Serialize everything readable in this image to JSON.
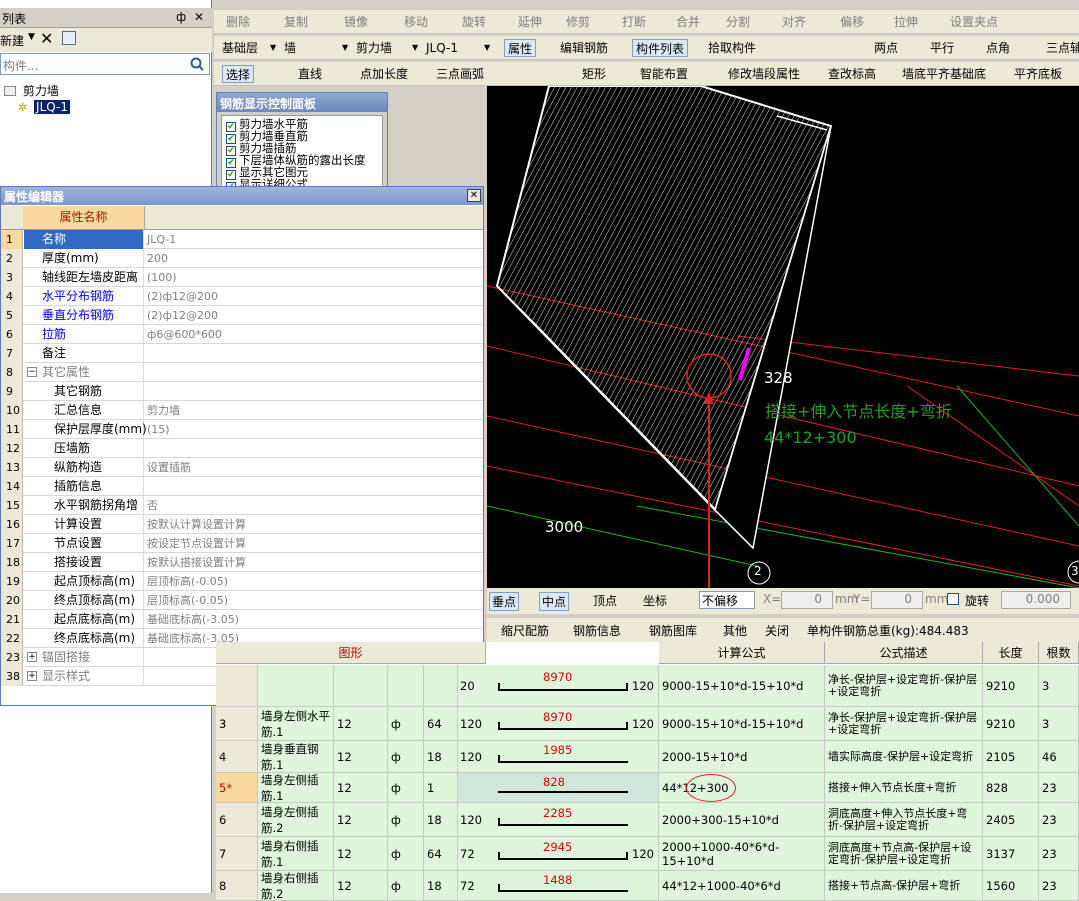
{
  "left_panel": {
    "title": "列表",
    "pin": "ф",
    "close": "✕",
    "new_label": "新建",
    "search_placeholder": "构件...",
    "tree_root": "剪力墙",
    "tree_child": "JLQ-1"
  },
  "toolbar1": [
    "删除",
    "复制",
    "镜像",
    "移动",
    "旋转",
    "延伸",
    "修剪",
    "打断",
    "合并",
    "分割",
    "对齐",
    "偏移",
    "拉伸",
    "设置夹点"
  ],
  "toolbar2": {
    "layer": "基础层",
    "type": "墙",
    "subtype": "剪力墙",
    "member": "JLQ-1",
    "btn_props": "属性",
    "btn_edit": "编辑钢筋",
    "btn_list": "构件列表",
    "btn_pick": "拾取构件",
    "btn_twopoint": "两点",
    "btn_parallel": "平行",
    "btn_angle": "点角",
    "btn_three": "三点辅"
  },
  "toolbar3": {
    "select": "选择",
    "line": "直线",
    "point_len": "点加长度",
    "arc": "三点画弧",
    "rect": "矩形",
    "smart": "智能布置",
    "modify": "修改墙段属性",
    "elev": "查改标高",
    "align_base": "墙底平齐基础底",
    "align_slab": "平齐底板"
  },
  "rebar_panel": {
    "title": "钢筋显示控制面板",
    "items": [
      "剪力墙水平筋",
      "剪力墙垂直筋",
      "剪力墙插筋",
      "下层墙体纵筋的露出长度",
      "显示其它图元",
      "显示详细公式"
    ]
  },
  "prop_editor": {
    "title": "属性编辑器",
    "col_name": "属性名称",
    "rows": [
      {
        "n": "1",
        "name": "名称",
        "val": "JLQ-1"
      },
      {
        "n": "2",
        "name": "厚度(mm)",
        "val": "200"
      },
      {
        "n": "3",
        "name": "轴线距左墙皮距离",
        "val": "(100)"
      },
      {
        "n": "4",
        "name": "水平分布钢筋",
        "val": "(2)ф12@200"
      },
      {
        "n": "5",
        "name": "垂直分布钢筋",
        "val": "(2)ф12@200"
      },
      {
        "n": "6",
        "name": "拉筋",
        "val": "ф6@600*600"
      },
      {
        "n": "7",
        "name": "备注",
        "val": ""
      },
      {
        "n": "8",
        "name": "其它属性",
        "val": ""
      },
      {
        "n": "9",
        "name": "其它钢筋",
        "val": ""
      },
      {
        "n": "10",
        "name": "汇总信息",
        "val": "剪力墙"
      },
      {
        "n": "11",
        "name": "保护层厚度(mm)",
        "val": "(15)"
      },
      {
        "n": "12",
        "name": "压墙筋",
        "val": ""
      },
      {
        "n": "13",
        "name": "纵筋构造",
        "val": "设置插筋"
      },
      {
        "n": "14",
        "name": "插筋信息",
        "val": ""
      },
      {
        "n": "15",
        "name": "水平钢筋拐角增",
        "val": "否"
      },
      {
        "n": "16",
        "name": "计算设置",
        "val": "按默认计算设置计算"
      },
      {
        "n": "17",
        "name": "节点设置",
        "val": "按设定节点设置计算"
      },
      {
        "n": "18",
        "name": "搭接设置",
        "val": "按默认搭接设置计算"
      },
      {
        "n": "19",
        "name": "起点顶标高(m)",
        "val": "层顶标高(-0.05)"
      },
      {
        "n": "20",
        "name": "终点顶标高(m)",
        "val": "层顶标高(-0.05)"
      },
      {
        "n": "21",
        "name": "起点底标高(m)",
        "val": "基础底标高(-3.05)"
      },
      {
        "n": "22",
        "name": "终点底标高(m)",
        "val": "基础底标高(-3.05)"
      },
      {
        "n": "23",
        "name": "锚固搭接",
        "val": ""
      },
      {
        "n": "38",
        "name": "显示样式",
        "val": ""
      }
    ]
  },
  "canvas": {
    "label_328": "328",
    "label_formula_desc": "搭接+伸入节点长度+弯折",
    "label_formula": "44*12+300",
    "label_3000": "3000",
    "label_2": "2",
    "label_3": "3"
  },
  "snap_bar": {
    "perp": "垂点",
    "mid": "中点",
    "vertex": "顶点",
    "coord": "坐标",
    "offset": "不偏移",
    "x_label": "X=",
    "x_val": "0",
    "y_label": "Y=",
    "y_val": "0",
    "unit": "mm",
    "rotate": "旋转",
    "rot_val": "0.000"
  },
  "bottom_bar": {
    "ruler": "缩尺配筋",
    "info": "钢筋信息",
    "lib": "钢筋图库",
    "other": "其他",
    "close": "关闭",
    "weight": "单构件钢筋总重(kg):484.483"
  },
  "table": {
    "headers": [
      "图形",
      "计算公式",
      "公式描述",
      "长度(mm)",
      "根数"
    ],
    "rows": [
      {
        "no": "",
        "name": "",
        "d": "",
        "lvl": "",
        "cnt": "",
        "lft": "20",
        "mid": "8970",
        "rgt": "120",
        "formula": "9000-15+10*d-15+10*d",
        "desc": "净长-保护层+设定弯折-保护层+设定弯折",
        "len": "9210",
        "num": "3"
      },
      {
        "no": "3",
        "name": "墙身左侧水平筋.1",
        "d": "12",
        "lvl": "ф",
        "cnt": "64",
        "lft": "120",
        "mid": "8970",
        "rgt": "120",
        "formula": "9000-15+10*d-15+10*d",
        "desc": "净长-保护层+设定弯折-保护层+设定弯折",
        "len": "9210",
        "num": "3"
      },
      {
        "no": "4",
        "name": "墙身垂直钢筋.1",
        "d": "12",
        "lvl": "ф",
        "cnt": "18",
        "lft": "120",
        "mid": "1985",
        "rgt": "",
        "formula": "2000-15+10*d",
        "desc": "墙实际高度-保护层+设定弯折",
        "len": "2105",
        "num": "46"
      },
      {
        "no": "5*",
        "name": "墙身左侧插筋.1",
        "d": "12",
        "lvl": "ф",
        "cnt": "1",
        "lft": "",
        "mid": "828",
        "rgt": "",
        "formula": "44*12+300",
        "desc": "搭接+伸入节点长度+弯折",
        "len": "828",
        "num": "23"
      },
      {
        "no": "6",
        "name": "墙身左侧插筋.2",
        "d": "12",
        "lvl": "ф",
        "cnt": "18",
        "lft": "120",
        "mid": "2285",
        "rgt": "",
        "formula": "2000+300-15+10*d",
        "desc": "洞底高度+伸入节点长度+弯折-保护层+设定弯折",
        "len": "2405",
        "num": "23"
      },
      {
        "no": "7",
        "name": "墙身右侧插筋.1",
        "d": "12",
        "lvl": "ф",
        "cnt": "64",
        "lft": "72",
        "mid": "2945",
        "rgt": "120",
        "formula": "2000+1000-40*6*d-15+10*d",
        "desc": "洞底高度+节点高-保护层+设定弯折-保护层+设定弯折",
        "len": "3137",
        "num": "23"
      },
      {
        "no": "8",
        "name": "墙身右侧插筋.2",
        "d": "12",
        "lvl": "ф",
        "cnt": "18",
        "lft": "72",
        "mid": "1488",
        "rgt": "",
        "formula": "44*12+1000-40*6*d",
        "desc": "搭接+节点高-保护层+弯折",
        "len": "1560",
        "num": "23"
      }
    ]
  }
}
